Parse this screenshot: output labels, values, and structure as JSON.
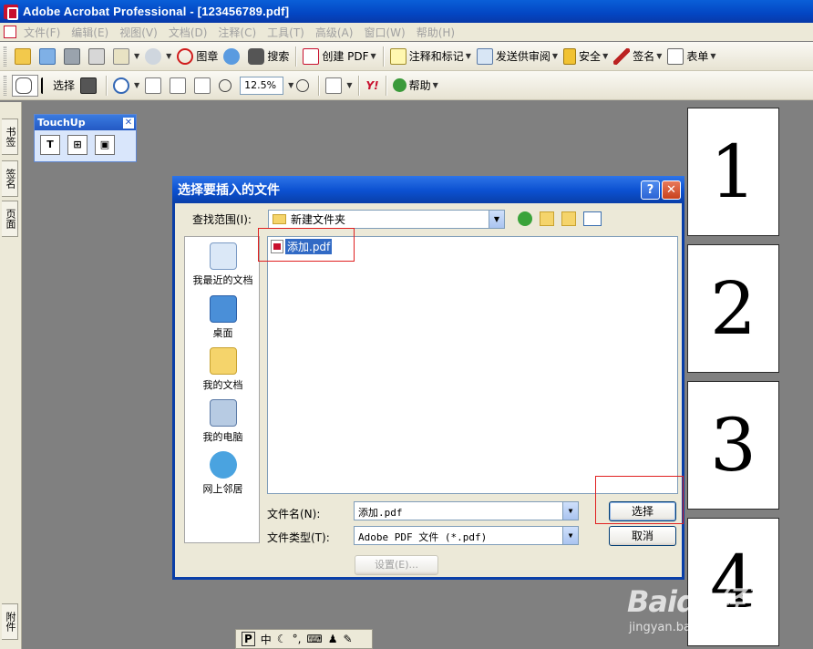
{
  "window": {
    "title": "Adobe Acrobat Professional - [123456789.pdf]"
  },
  "menu": [
    "文件(F)",
    "编辑(E)",
    "视图(V)",
    "文档(D)",
    "注释(C)",
    "工具(T)",
    "高级(A)",
    "窗口(W)",
    "帮助(H)"
  ],
  "toolbar1": {
    "stamp": "图章",
    "search": "搜索",
    "create_pdf": "创建 PDF",
    "comment": "注释和标记",
    "review": "发送供审阅",
    "security": "安全",
    "sign": "签名",
    "forms": "表单"
  },
  "toolbar2": {
    "select": "选择",
    "zoom": "12.5%",
    "help": "帮助",
    "yahoo": "Y!"
  },
  "left_tabs": [
    "书签",
    "签名",
    "页面",
    "附件"
  ],
  "touchup": {
    "title": "TouchUp"
  },
  "thumbnails": [
    "1",
    "2",
    "3",
    "4"
  ],
  "dialog": {
    "title": "选择要插入的文件",
    "help_glyph": "?",
    "close_glyph": "✕",
    "look_in_label": "查找范围(I):",
    "look_in_value": "新建文件夹",
    "places": [
      "我最近的文档",
      "桌面",
      "我的文档",
      "我的电脑",
      "网上邻居"
    ],
    "files": [
      "添加.pdf"
    ],
    "filename_label": "文件名(N):",
    "filename_value": "添加.pdf",
    "filetype_label": "文件类型(T):",
    "filetype_value": "Adobe PDF 文件 (*.pdf)",
    "settings_button": "设置(E)...",
    "select_button": "选择",
    "cancel_button": "取消"
  },
  "ime_bar": {
    "mode": "中"
  },
  "watermark": {
    "logo": "Baidu经验",
    "url": "jingyan.baidu.com"
  },
  "colors": {
    "titlebar": "#0346c3",
    "highlight": "#e02020",
    "selection": "#316ac5"
  }
}
